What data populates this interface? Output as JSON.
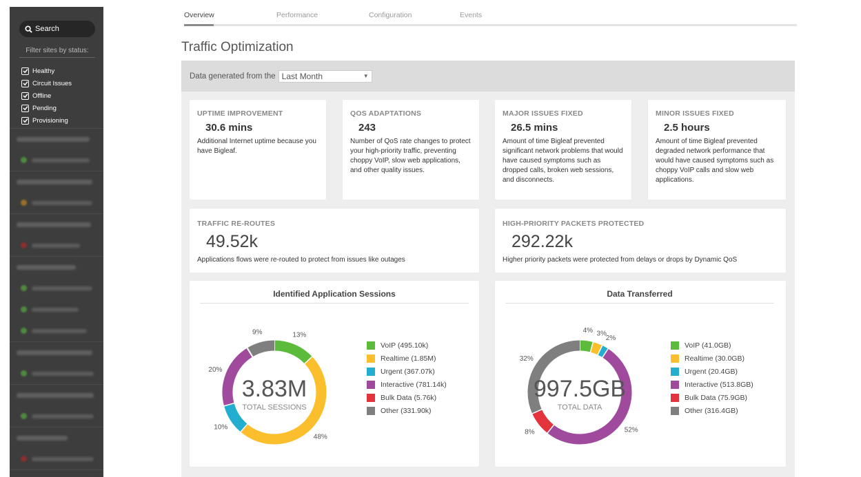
{
  "sidebar": {
    "search_placeholder": "Search",
    "filter_label": "Filter sites by status:",
    "filters": [
      "Healthy",
      "Circuit Issues",
      "Offline",
      "Pending",
      "Provisioning"
    ]
  },
  "tabs": [
    "Overview",
    "Performance",
    "Configuration",
    "Events"
  ],
  "page_title": "Traffic Optimization",
  "data_generated": {
    "label": "Data generated from the",
    "selected": "Last Month"
  },
  "cards": [
    {
      "title": "UPTIME IMPROVEMENT",
      "value": "30.6 mins",
      "desc": "Additional Internet uptime because you have Bigleaf."
    },
    {
      "title": "QOS ADAPTATIONS",
      "value": "243",
      "desc": "Number of QoS rate changes to protect your high-priority traffic, preventing choppy VoIP, slow web applications, and other quality issues."
    },
    {
      "title": "MAJOR ISSUES FIXED",
      "value": "26.5 mins",
      "desc": "Amount of time Bigleaf prevented significant network problems that would have caused symptoms such as dropped calls, broken web sessions, and disconnects."
    },
    {
      "title": "MINOR ISSUES FIXED",
      "value": "2.5 hours",
      "desc": "Amount of time Bigleaf prevented degraded network performance that would have caused symptoms such as choppy VoIP calls and slow web applications."
    }
  ],
  "wide_cards": [
    {
      "title": "TRAFFIC RE-ROUTES",
      "value": "49.52k",
      "desc": "Applications flows were re-routed to protect from issues like outages"
    },
    {
      "title": "HIGH-PRIORITY PACKETS PROTECTED",
      "value": "292.22k",
      "desc": "Higher priority packets were protected from delays or drops by Dynamic QoS"
    }
  ],
  "colors": {
    "voip": "#5dbb3c",
    "realtime": "#fbbf2d",
    "urgent": "#23aecf",
    "interactive": "#a04a9e",
    "bulk": "#e3343e",
    "other": "#7f7f7f"
  },
  "chart_data": [
    {
      "type": "pie",
      "title": "Identified Application Sessions",
      "center_value": "3.83M",
      "center_label": "TOTAL SESSIONS",
      "categories": [
        "VoIP",
        "Realtime",
        "Urgent",
        "Interactive",
        "Bulk Data",
        "Other"
      ],
      "values": [
        495.1,
        1850,
        367.07,
        781.14,
        5.76,
        331.9
      ],
      "legend": [
        "VoIP (495.10k)",
        "Realtime (1.85M)",
        "Urgent (367.07k)",
        "Interactive (781.14k)",
        "Bulk Data (5.76k)",
        "Other (331.90k)"
      ],
      "labels": [
        "13%",
        "48%",
        "10%",
        "20%",
        "",
        "9%"
      ]
    },
    {
      "type": "pie",
      "title": "Data Transferred",
      "center_value": "997.5GB",
      "center_label": "TOTAL DATA",
      "categories": [
        "VoIP",
        "Realtime",
        "Urgent",
        "Interactive",
        "Bulk Data",
        "Other"
      ],
      "values": [
        41.0,
        30.0,
        20.4,
        513.8,
        75.9,
        316.4
      ],
      "legend": [
        "VoIP (41.0GB)",
        "Realtime (30.0GB)",
        "Urgent (20.4GB)",
        "Interactive (513.8GB)",
        "Bulk Data (75.9GB)",
        "Other (316.4GB)"
      ],
      "labels": [
        "4%",
        "3%",
        "2%",
        "52%",
        "8%",
        "32%"
      ]
    }
  ]
}
